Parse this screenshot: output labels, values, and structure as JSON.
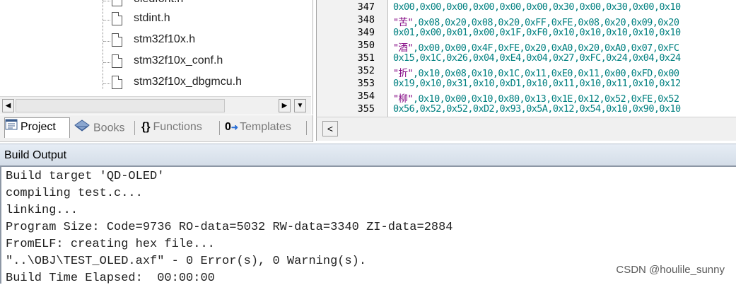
{
  "project_tree": {
    "files": [
      {
        "name": "oledfont.h",
        "partial": true
      },
      {
        "name": "stdint.h"
      },
      {
        "name": "stm32f10x.h"
      },
      {
        "name": "stm32f10x_conf.h"
      },
      {
        "name": "stm32f10x_dbgmcu.h"
      }
    ]
  },
  "tabs": [
    {
      "label": "Project",
      "icon": "project-icon",
      "active": true
    },
    {
      "label": "Books",
      "icon": "books-icon"
    },
    {
      "label": "Functions",
      "icon": "functions-icon",
      "glyph": "{}"
    },
    {
      "label": "Templates",
      "icon": "templates-icon",
      "glyph": "0→"
    }
  ],
  "editor": {
    "lines": [
      {
        "no": "347",
        "text": "0x00,0x00,0x00,0x00,0x00,0x00,0x30,0x00,0x30,0x00,0x10"
      },
      {
        "no": "348",
        "str": "\"苦\"",
        "text": ",0x08,0x20,0x08,0x20,0xFF,0xFE,0x08,0x20,0x09,0x20"
      },
      {
        "no": "349",
        "text": "0x01,0x00,0x01,0x00,0x1F,0xF0,0x10,0x10,0x10,0x10,0x10"
      },
      {
        "no": "350",
        "str": "\"酒\"",
        "text": ",0x00,0x00,0x4F,0xFE,0x20,0xA0,0x20,0xA0,0x07,0xFC"
      },
      {
        "no": "351",
        "text": "0x15,0x1C,0x26,0x04,0xE4,0x04,0x27,0xFC,0x24,0x04,0x24"
      },
      {
        "no": "352",
        "str": "\"折\"",
        "text": ",0x10,0x08,0x10,0x1C,0x11,0xE0,0x11,0x00,0xFD,0x00"
      },
      {
        "no": "353",
        "text": "0x19,0x10,0x31,0x10,0xD1,0x10,0x11,0x10,0x11,0x10,0x12"
      },
      {
        "no": "354",
        "str": "\"柳\"",
        "text": ",0x10,0x00,0x10,0x80,0x13,0x1E,0x12,0x52,0xFE,0x52"
      },
      {
        "no": "355",
        "text": "0x56,0x52,0x52,0xD2,0x93,0x5A,0x12,0x54,0x10,0x90,0x10"
      }
    ]
  },
  "build_output": {
    "title": "Build Output",
    "lines": [
      "Build target 'QD-OLED'",
      "compiling test.c...",
      "linking...",
      "Program Size: Code=9736 RO-data=5032 RW-data=3340 ZI-data=2884",
      "FromELF: creating hex file...",
      "\"..\\OBJ\\TEST_OLED.axf\" - 0 Error(s), 0 Warning(s).",
      "Build Time Elapsed:  00:00:00"
    ]
  },
  "watermark": "CSDN @houlile_sunny",
  "colors": {
    "code_hex": "#008080",
    "code_string": "#800080",
    "panel_bg": "#f0f0f0"
  }
}
